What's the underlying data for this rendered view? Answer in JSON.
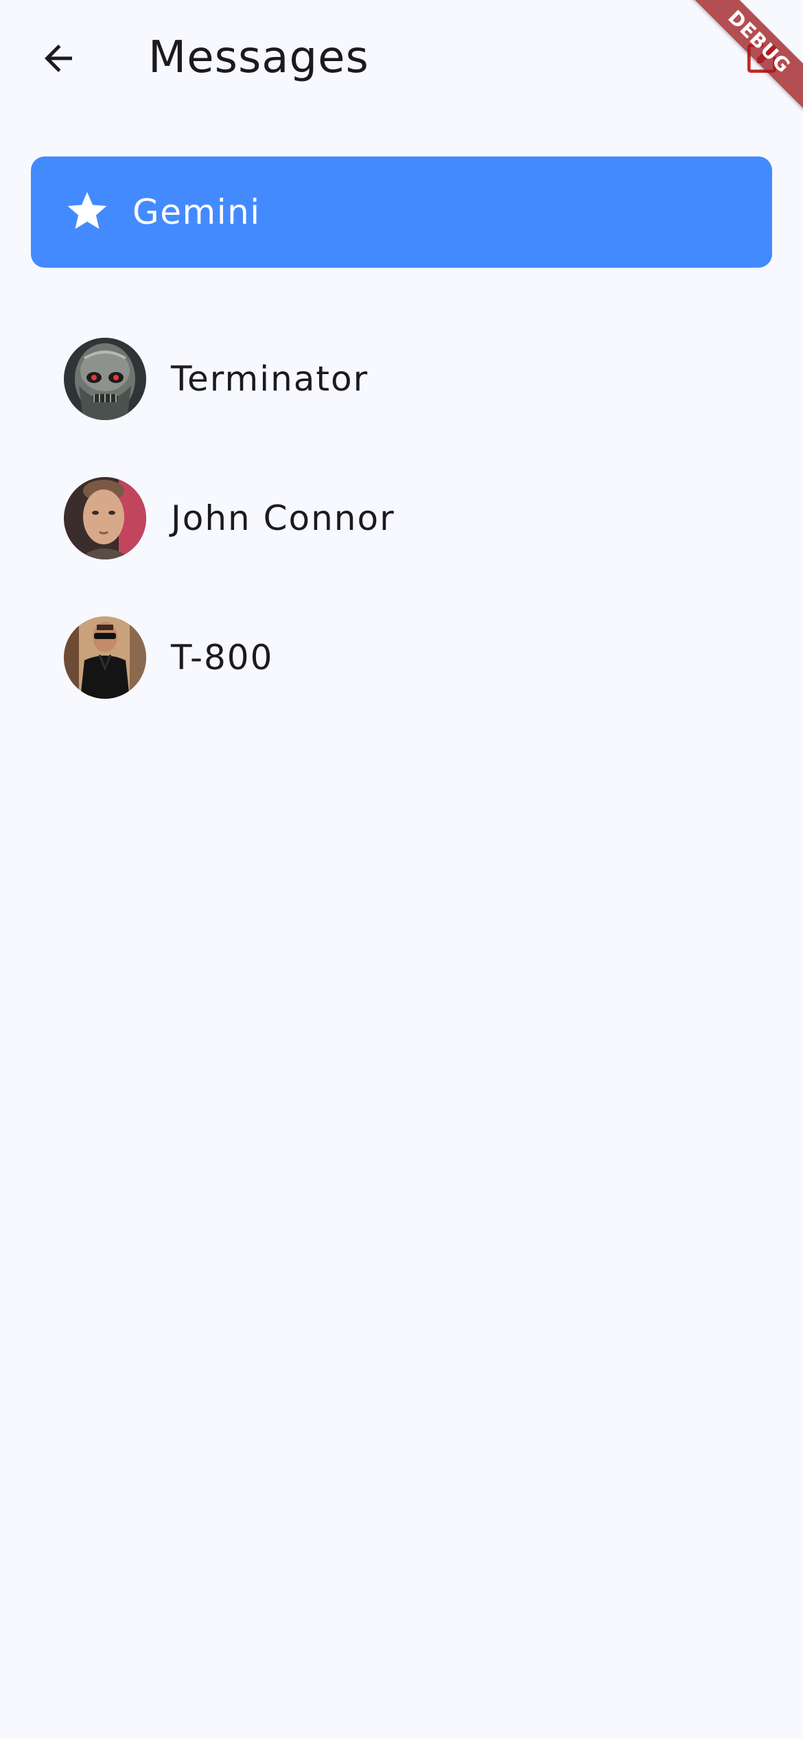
{
  "app_bar": {
    "title": "Messages",
    "back_icon": "arrow-back-icon",
    "action_icon": "compose-icon"
  },
  "debug_banner": {
    "label": "DEBUG"
  },
  "gemini": {
    "label": "Gemini",
    "icon": "star-icon",
    "color": "#448aff"
  },
  "contacts": [
    {
      "name": "Terminator",
      "avatar": "terminator-avatar"
    },
    {
      "name": "John Connor",
      "avatar": "john-connor-avatar"
    },
    {
      "name": "T-800",
      "avatar": "t800-avatar"
    }
  ],
  "colors": {
    "background": "#f7f9fe",
    "text": "#1b1b1f",
    "accent": "#448aff"
  }
}
